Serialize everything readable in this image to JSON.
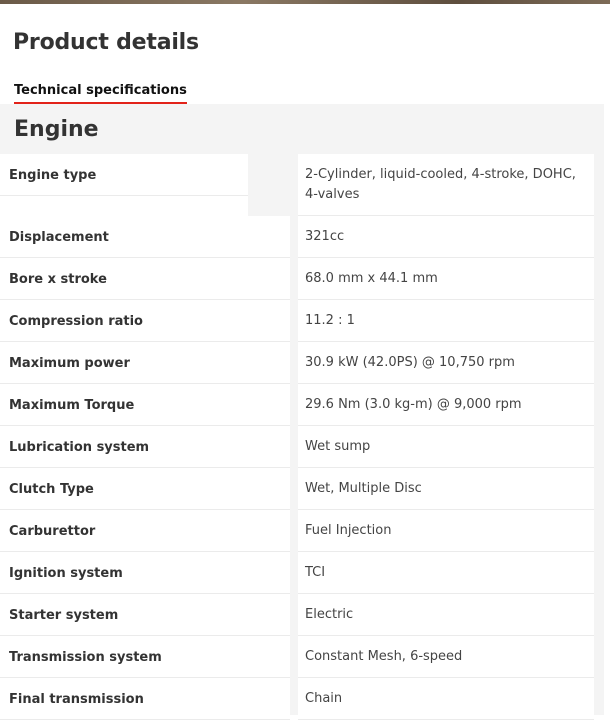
{
  "page": {
    "title": "Product details"
  },
  "tabs": [
    {
      "label": "Technical specifications",
      "active": true
    }
  ],
  "section": {
    "title": "Engine"
  },
  "specs": [
    {
      "label": "Engine type",
      "value": "2-Cylinder, liquid-cooled, 4-stroke, DOHC, 4-valves"
    },
    {
      "label": "Displacement",
      "value": "321cc"
    },
    {
      "label": "Bore x stroke",
      "value": "68.0 mm x 44.1 mm"
    },
    {
      "label": "Compression ratio",
      "value": "11.2 : 1"
    },
    {
      "label": "Maximum power",
      "value": "30.9 kW (42.0PS) @ 10,750 rpm"
    },
    {
      "label": "Maximum Torque",
      "value": "29.6 Nm (3.0 kg-m) @ 9,000 rpm"
    },
    {
      "label": "Lubrication system",
      "value": "Wet sump"
    },
    {
      "label": "Clutch Type",
      "value": "Wet, Multiple Disc"
    },
    {
      "label": "Carburettor",
      "value": "Fuel Injection"
    },
    {
      "label": "Ignition system",
      "value": "TCI"
    },
    {
      "label": "Starter system",
      "value": "Electric"
    },
    {
      "label": "Transmission system",
      "value": "Constant Mesh, 6-speed"
    },
    {
      "label": "Final transmission",
      "value": "Chain"
    }
  ],
  "colors": {
    "tab_underline": "#e2231a",
    "panel_background": "#f4f4f4"
  }
}
